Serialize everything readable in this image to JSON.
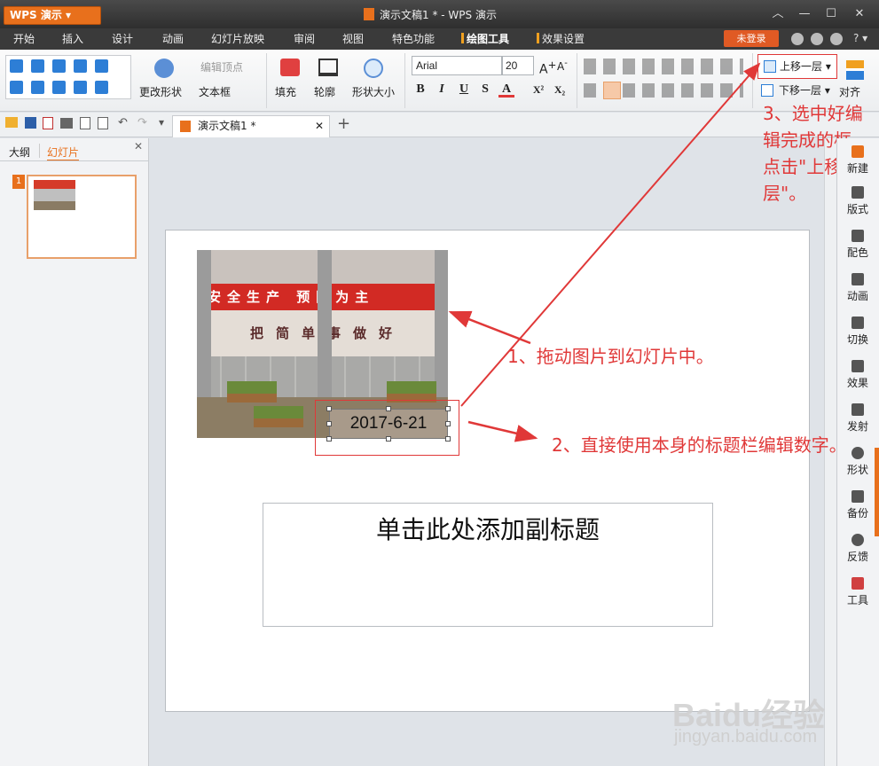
{
  "app": {
    "name": "WPS 演示",
    "title": "演示文稿1 * - WPS 演示"
  },
  "menu": [
    "开始",
    "插入",
    "设计",
    "动画",
    "幻灯片放映",
    "审阅",
    "视图",
    "特色功能",
    "绘图工具",
    "效果设置"
  ],
  "login": "未登录",
  "ribbon": {
    "edit_points": "编辑顶点",
    "change_shape": "更改形状",
    "text_box": "文本框",
    "fill": "填充",
    "outline": "轮廓",
    "shape_size": "形状大小",
    "font_name": "Arial",
    "font_size": "20",
    "bring_forward": "上移一层",
    "send_backward": "下移一层",
    "align": "对齐"
  },
  "doc_tab": "演示文稿1 *",
  "panel": {
    "outline_tab": "大纲",
    "slides_tab": "幻灯片",
    "slide_number": "1"
  },
  "slide": {
    "banner_text": "安全生产 预防为主",
    "wall_text": "把简单事做好",
    "date_text": "2017-6-21",
    "subtitle_placeholder": "单击此处添加副标题"
  },
  "annotations": {
    "step1": "1、拖动图片到幻灯片中。",
    "step2": "2、直接使用本身的标题栏编辑数字。",
    "step3": "3、选中好编辑完成的框，点击\"上移一层\"。"
  },
  "right_sidebar": [
    "新建",
    "版式",
    "配色",
    "动画",
    "切换",
    "效果",
    "发射",
    "形状",
    "备份",
    "反馈",
    "工具"
  ],
  "watermark": {
    "logo": "Baidu经验",
    "url": "jingyan.baidu.com"
  },
  "colors": {
    "accent": "#e8701c",
    "annotation": "#e03838",
    "ribbon_tab_mark": "#f0a020"
  }
}
